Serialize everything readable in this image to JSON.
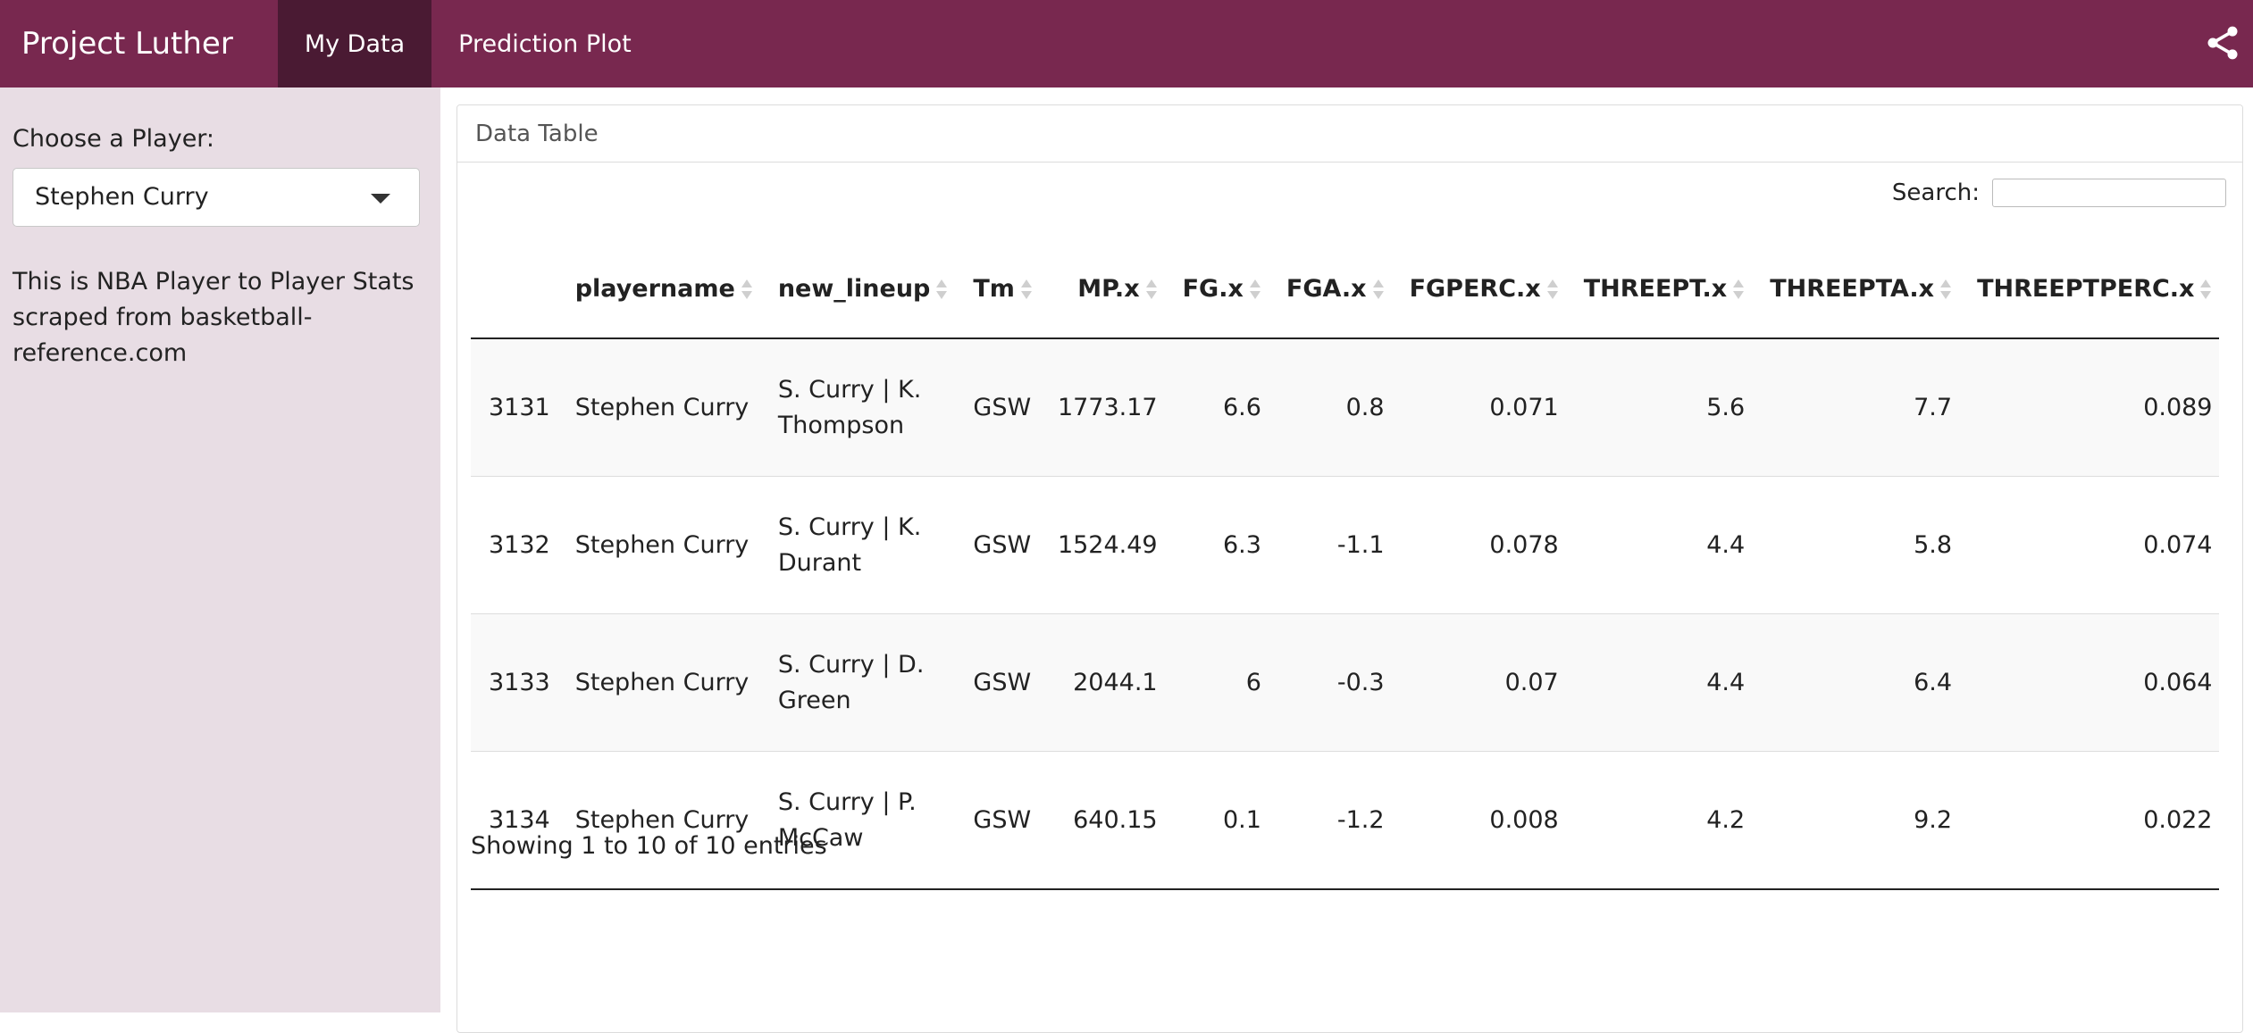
{
  "navbar": {
    "brand": "Project Luther",
    "tabs": [
      {
        "label": "My Data",
        "active": true
      },
      {
        "label": "Prediction Plot",
        "active": false
      }
    ],
    "share_icon": "share-icon"
  },
  "sidebar": {
    "label": "Choose a Player:",
    "selected_player": "Stephen Curry",
    "description": "This is NBA Player to Player Stats scraped from basketball-reference.com"
  },
  "panel": {
    "title": "Data Table",
    "search_label": "Search:",
    "search_value": "",
    "columns": [
      "",
      "playername",
      "new_lineup",
      "Tm",
      "MP.x",
      "FG.x",
      "FGA.x",
      "FGPERC.x",
      "THREEPT.x",
      "THREEPTA.x",
      "THREEPTPERC.x"
    ],
    "rows": [
      [
        "3131",
        "Stephen Curry",
        "S. Curry | K. Thompson",
        "GSW",
        "1773.17",
        "6.6",
        "0.8",
        "0.071",
        "5.6",
        "7.7",
        "0.089"
      ],
      [
        "3132",
        "Stephen Curry",
        "S. Curry | K. Durant",
        "GSW",
        "1524.49",
        "6.3",
        "-1.1",
        "0.078",
        "4.4",
        "5.8",
        "0.074"
      ],
      [
        "3133",
        "Stephen Curry",
        "S. Curry | D. Green",
        "GSW",
        "2044.1",
        "6",
        "-0.3",
        "0.07",
        "4.4",
        "6.4",
        "0.064"
      ],
      [
        "3134",
        "Stephen Curry",
        "S. Curry | P. McCaw",
        "GSW",
        "640.15",
        "0.1",
        "-1.2",
        "0.008",
        "4.2",
        "9.2",
        "0.022"
      ]
    ],
    "info": "Showing 1 to 10 of 10 entries"
  },
  "colors": {
    "navbar": "#78284f",
    "navbar_active": "#4a1a33",
    "sidebar": "#e8dde4"
  }
}
